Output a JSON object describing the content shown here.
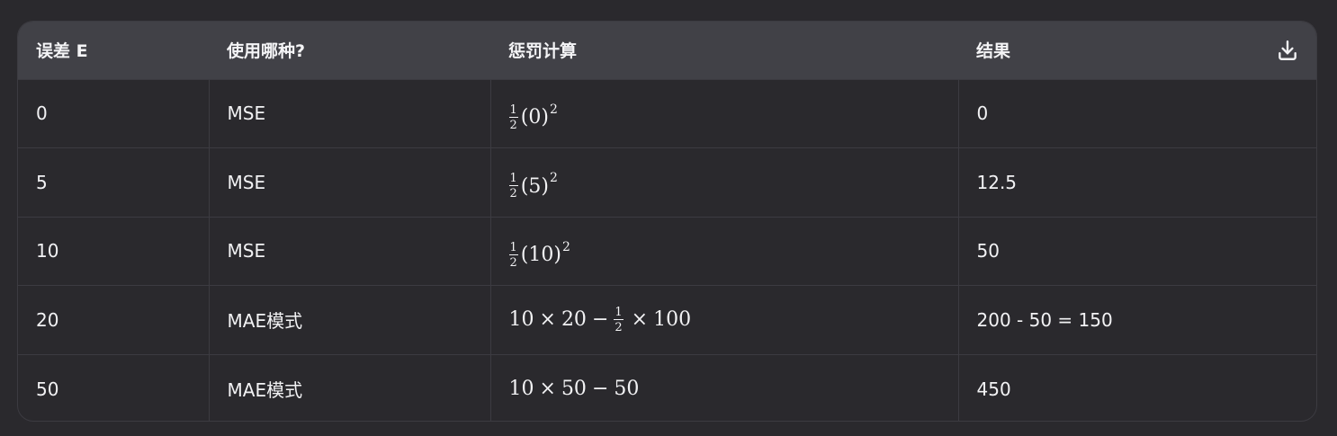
{
  "table": {
    "headers": [
      "误差 E",
      "使用哪种?",
      "惩罚计算",
      "结果"
    ],
    "download_icon": "download-icon",
    "rows": [
      {
        "error": "0",
        "mode": "MSE",
        "calc": {
          "kind": "half_square",
          "num": "1",
          "den": "2",
          "arg": "(0)",
          "exp": "2"
        },
        "result": "0"
      },
      {
        "error": "5",
        "mode": "MSE",
        "calc": {
          "kind": "half_square",
          "num": "1",
          "den": "2",
          "arg": "(5)",
          "exp": "2"
        },
        "result": "12.5"
      },
      {
        "error": "10",
        "mode": "MSE",
        "calc": {
          "kind": "half_square",
          "num": "1",
          "den": "2",
          "arg": "(10)",
          "exp": "2"
        },
        "result": "50"
      },
      {
        "error": "20",
        "mode": "MAE模式",
        "calc": {
          "kind": "linear_minus_frac",
          "a": "10",
          "times": "×",
          "b": "20",
          "minus": "−",
          "num": "1",
          "den": "2",
          "times2": "×",
          "c": "100"
        },
        "result": "200 - 50 = 150"
      },
      {
        "error": "50",
        "mode": "MAE模式",
        "calc": {
          "kind": "linear_minus",
          "a": "10",
          "times": "×",
          "b": "50",
          "minus": "−",
          "c": "50"
        },
        "result": "450"
      }
    ]
  },
  "colors": {
    "background": "#2a292d",
    "header_background": "#414147",
    "border": "#3c3b41",
    "text": "#f2f2f4"
  }
}
